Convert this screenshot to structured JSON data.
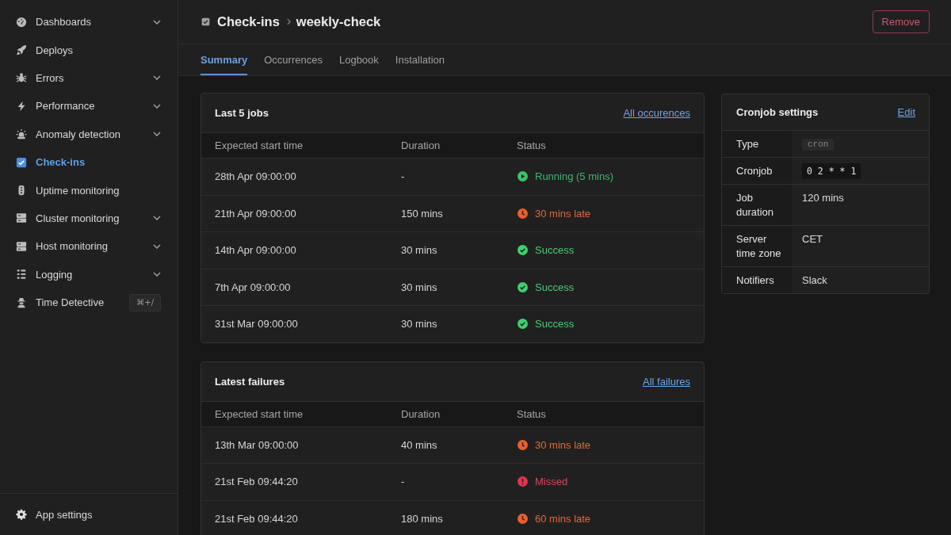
{
  "sidebar": {
    "items": [
      {
        "label": "Dashboards",
        "expandable": true,
        "selected": false
      },
      {
        "label": "Deploys",
        "expandable": false,
        "selected": false
      },
      {
        "label": "Errors",
        "expandable": true,
        "selected": false
      },
      {
        "label": "Performance",
        "expandable": true,
        "selected": false
      },
      {
        "label": "Anomaly detection",
        "expandable": true,
        "selected": false
      },
      {
        "label": "Check-ins",
        "expandable": false,
        "selected": true
      },
      {
        "label": "Uptime monitoring",
        "expandable": false,
        "selected": false
      },
      {
        "label": "Cluster monitoring",
        "expandable": true,
        "selected": false
      },
      {
        "label": "Host monitoring",
        "expandable": true,
        "selected": false
      },
      {
        "label": "Logging",
        "expandable": true,
        "selected": false
      },
      {
        "label": "Time Detective",
        "expandable": false,
        "selected": false,
        "shortcut": "⌘+/"
      }
    ],
    "footer_item": {
      "label": "App settings"
    }
  },
  "header": {
    "breadcrumb": [
      "Check-ins",
      "weekly-check"
    ],
    "remove_button": "Remove"
  },
  "tabs": [
    {
      "label": "Summary",
      "selected": true
    },
    {
      "label": "Occurrences",
      "selected": false
    },
    {
      "label": "Logbook",
      "selected": false
    },
    {
      "label": "Installation",
      "selected": false
    }
  ],
  "last_jobs": {
    "title": "Last 5 jobs",
    "link": "All occurences",
    "columns": [
      "Expected start time",
      "Duration",
      "Status"
    ],
    "rows": [
      {
        "start_time": "28th Apr 09:00:00",
        "duration": "-",
        "status": {
          "kind": "running",
          "text": "Running (5 mins)"
        }
      },
      {
        "start_time": "21th Apr 09:00:00",
        "duration": "150 mins",
        "status": {
          "kind": "late",
          "text": "30 mins late"
        }
      },
      {
        "start_time": "14th Apr 09:00:00",
        "duration": "30 mins",
        "status": {
          "kind": "success",
          "text": "Success"
        }
      },
      {
        "start_time": "7th Apr 09:00:00",
        "duration": "30 mins",
        "status": {
          "kind": "success",
          "text": "Success"
        }
      },
      {
        "start_time": "31st Mar 09:00:00",
        "duration": "30 mins",
        "status": {
          "kind": "success",
          "text": "Success"
        }
      }
    ]
  },
  "latest_failures": {
    "title": "Latest failures",
    "link": "All failures",
    "columns": [
      "Expected start time",
      "Duration",
      "Status"
    ],
    "rows": [
      {
        "start_time": "13th Mar 09:00:00",
        "duration": "40 mins",
        "status": {
          "kind": "late",
          "text": "30 mins late"
        }
      },
      {
        "start_time": "21st Feb 09:44:20",
        "duration": "-",
        "status": {
          "kind": "missed",
          "text": "Missed"
        }
      },
      {
        "start_time": "21st Feb 09:44:20",
        "duration": "180 mins",
        "status": {
          "kind": "late",
          "text": "60 mins late"
        }
      }
    ]
  },
  "cronjob_settings": {
    "title": "Cronjob settings",
    "link": "Edit",
    "rows": [
      {
        "label": "Type",
        "value": "cron",
        "kind": "tag"
      },
      {
        "label": "Cronjob",
        "value": "0 2 * * 1",
        "kind": "code"
      },
      {
        "label": "Job duration",
        "value": "120 mins",
        "kind": "text"
      },
      {
        "label": "Server time zone",
        "value": "CET",
        "kind": "text"
      },
      {
        "label": "Notifiers",
        "value": "Slack",
        "kind": "text"
      }
    ]
  }
}
